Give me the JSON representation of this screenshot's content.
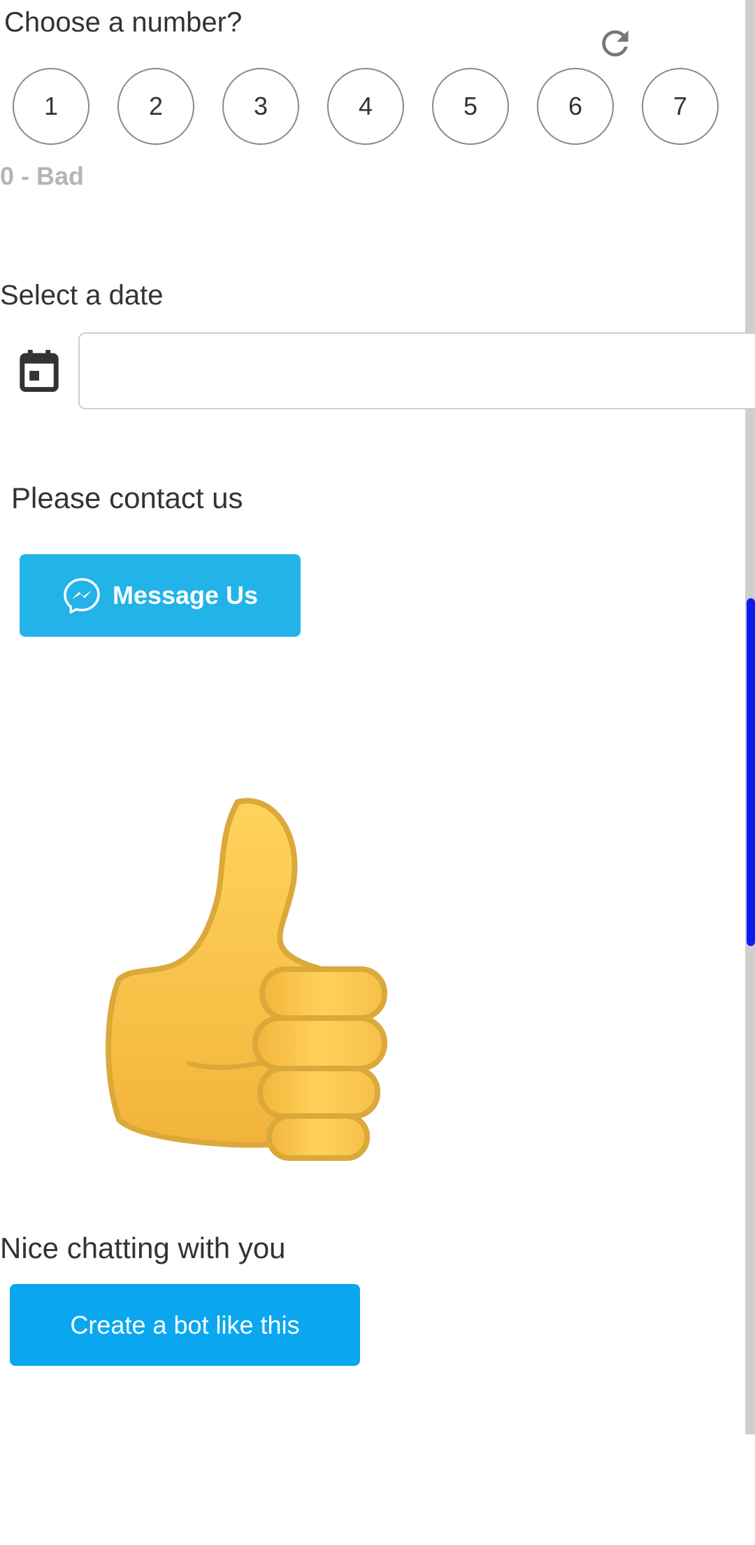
{
  "rating": {
    "question": "Choose a number?",
    "options": [
      "1",
      "2",
      "3",
      "4",
      "5",
      "6",
      "7"
    ],
    "scale_label": "0 - Bad",
    "refresh_icon": "refresh-icon"
  },
  "date_picker": {
    "label": "Select a date",
    "icon": "calendar-icon",
    "value": "",
    "placeholder": ""
  },
  "contact": {
    "label": "Please contact us",
    "button_label": "Message Us",
    "button_icon": "messenger-icon",
    "button_color": "#22b3e8"
  },
  "sticker": {
    "icon": "thumbs-up-icon"
  },
  "footer": {
    "label": "Nice chatting with you",
    "button_label": "Create a bot like this",
    "button_color": "#0aa7f0"
  },
  "scrollbar": {
    "thumb_color": "#0a1cf0"
  }
}
